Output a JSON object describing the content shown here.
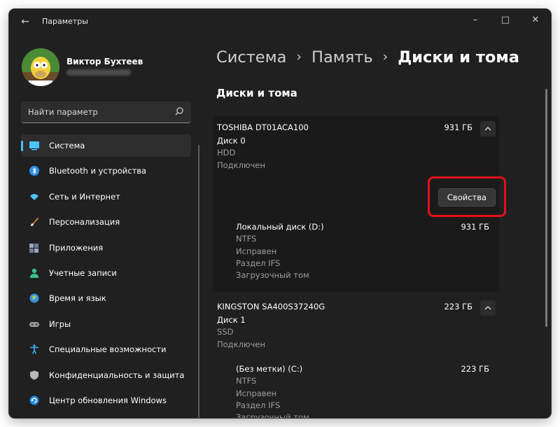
{
  "window": {
    "title": "Параметры"
  },
  "profile": {
    "name": "Виктор Бухтеев"
  },
  "search": {
    "placeholder": "Найти параметр"
  },
  "nav": {
    "items": [
      {
        "label": "Система",
        "icon": "display-icon"
      },
      {
        "label": "Bluetooth и устройства",
        "icon": "bluetooth-icon"
      },
      {
        "label": "Сеть и Интернет",
        "icon": "wifi-icon"
      },
      {
        "label": "Персонализация",
        "icon": "brush-icon"
      },
      {
        "label": "Приложения",
        "icon": "apps-icon"
      },
      {
        "label": "Учетные записи",
        "icon": "person-icon"
      },
      {
        "label": "Время и язык",
        "icon": "globe-icon"
      },
      {
        "label": "Игры",
        "icon": "gamepad-icon"
      },
      {
        "label": "Специальные возможности",
        "icon": "accessibility-icon"
      },
      {
        "label": "Конфиденциальность и защита",
        "icon": "shield-icon"
      },
      {
        "label": "Центр обновления Windows",
        "icon": "update-icon"
      }
    ]
  },
  "breadcrumb": {
    "root": "Система",
    "middle": "Память",
    "current": "Диски и тома"
  },
  "section_title": "Диски и тома",
  "disks": [
    {
      "model": "TOSHIBA DT01ACA100",
      "size": "931 ГБ",
      "label": "Диск 0",
      "type": "HDD",
      "status": "Подключен",
      "properties_button": "Свойства",
      "volume": {
        "name": "Локальный диск (D:)",
        "size": "931 ГБ",
        "fs": "NTFS",
        "health": "Исправен",
        "partition": "Раздел IFS",
        "boot": "Загрузочный том"
      }
    },
    {
      "model": "KINGSTON SA400S37240G",
      "size": "223 ГБ",
      "label": "Диск 1",
      "type": "SSD",
      "status": "Подключен",
      "volume": {
        "name": "(Без метки) (C:)",
        "size": "223 ГБ",
        "fs": "NTFS",
        "health": "Исправен",
        "partition": "Раздел IFS",
        "boot": "Загрузочный том"
      }
    }
  ],
  "colors": {
    "accent": "#4cc2ff",
    "highlight": "#e3101a",
    "background": "#202020"
  }
}
